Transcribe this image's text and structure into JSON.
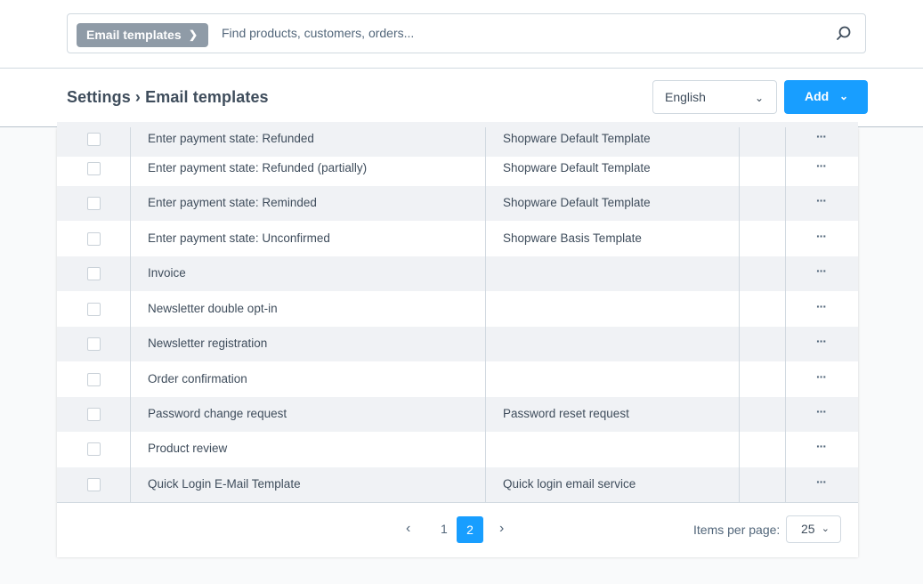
{
  "search": {
    "type_label": "Email templates",
    "placeholder": "Find products, customers, orders..."
  },
  "header": {
    "breadcrumb": "Settings › Email templates",
    "language": "English",
    "add_label": "Add"
  },
  "rows": [
    {
      "name": "Enter payment state: Refunded",
      "type": "Shopware Default Template"
    },
    {
      "name": "Enter payment state: Refunded (partially)",
      "type": "Shopware Default Template"
    },
    {
      "name": "Enter payment state: Reminded",
      "type": "Shopware Default Template"
    },
    {
      "name": "Enter payment state: Unconfirmed",
      "type": "Shopware Basis Template"
    },
    {
      "name": "Invoice",
      "type": ""
    },
    {
      "name": "Newsletter double opt-in",
      "type": ""
    },
    {
      "name": "Newsletter registration",
      "type": ""
    },
    {
      "name": "Order confirmation",
      "type": ""
    },
    {
      "name": "Password change request",
      "type": "Password reset request"
    },
    {
      "name": "Product review",
      "type": ""
    },
    {
      "name": "Quick Login E-Mail Template",
      "type": "Quick login email service"
    }
  ],
  "row_actions_label": "···",
  "pagination": {
    "pages": [
      "1",
      "2"
    ],
    "current": "2",
    "items_per_page_label": "Items per page:",
    "items_per_page": "25"
  },
  "colors": {
    "accent": "#189eff",
    "highlight": "#f0e000"
  }
}
